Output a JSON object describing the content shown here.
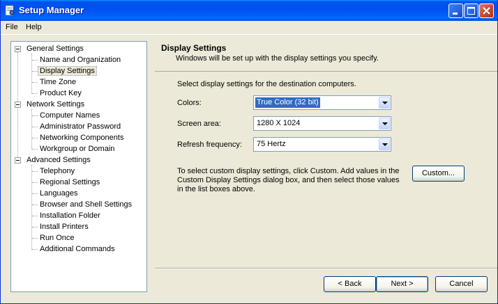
{
  "window": {
    "title": "Setup Manager",
    "icon": "setup-manager-icon",
    "controls": [
      "minimize-icon",
      "maximize-icon",
      "close-icon"
    ]
  },
  "menu": [
    "File",
    "Help"
  ],
  "tree": {
    "groups": [
      {
        "label": "General Settings",
        "items": [
          "Name and Organization",
          "Display Settings",
          "Time Zone",
          "Product Key"
        ]
      },
      {
        "label": "Network Settings",
        "items": [
          "Computer Names",
          "Administrator Password",
          "Networking Components",
          "Workgroup or Domain"
        ]
      },
      {
        "label": "Advanced Settings",
        "items": [
          "Telephony",
          "Regional Settings",
          "Languages",
          "Browser and Shell Settings",
          "Installation Folder",
          "Install Printers",
          "Run Once",
          "Additional Commands"
        ]
      }
    ],
    "selected": "Display Settings"
  },
  "header": {
    "title": "Display Settings",
    "subtitle": "Windows will be set up with the display settings you specify."
  },
  "content": {
    "instruction": "Select display settings for the destination computers.",
    "colors_label": "Colors:",
    "colors_value": "True Color (32 bit)",
    "screen_area_label": "Screen area:",
    "screen_area_value": "1280 X 1024",
    "refresh_label": "Refresh frequency:",
    "refresh_value": "75 Hertz",
    "custom_text": "To select custom display settings, click Custom. Add values in the Custom Display Settings dialog box, and then select those values in the list boxes above.",
    "custom_button": "Custom..."
  },
  "footer": {
    "back": "< Back",
    "next": "Next >",
    "cancel": "Cancel"
  },
  "colors": {
    "titlebar": "#0054e3",
    "window_bg": "#ece9d8",
    "selection": "#316ac5"
  }
}
